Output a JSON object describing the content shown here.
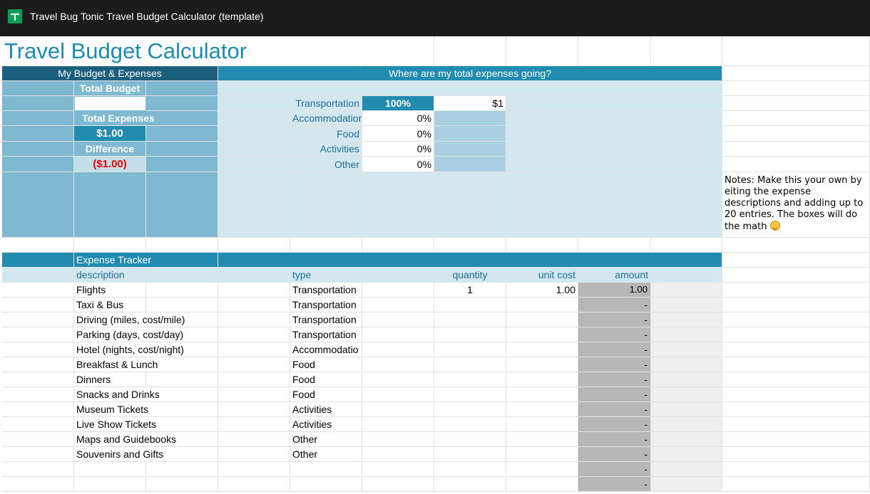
{
  "window": {
    "title": "Travel Bug Tonic Travel Budget Calculator (template)"
  },
  "sheet_title": "Travel Budget Calculator",
  "budget": {
    "header": "My Budget & Expenses",
    "total_budget_label": "Total Budget",
    "total_budget_value": "",
    "total_expenses_label": "Total Expenses",
    "total_expenses_value": "$1.00",
    "difference_label": "Difference",
    "difference_value": "($1.00)"
  },
  "breakdown": {
    "header": "Where are my total expenses going?",
    "rows": [
      {
        "category": "Transportation",
        "percent": "100%",
        "amount": "$1"
      },
      {
        "category": "Accommodation",
        "percent": "0%"
      },
      {
        "category": "Food",
        "percent": "0%"
      },
      {
        "category": "Activities",
        "percent": "0%"
      },
      {
        "category": "Other",
        "percent": "0%"
      }
    ]
  },
  "notes": {
    "text": "Notes: Make this your own by eiting the expense descriptions and adding up to 20 entries. The boxes will do the math"
  },
  "tracker": {
    "header": "Expense Tracker",
    "columns": {
      "description": "description",
      "type": "type",
      "quantity": "quantity",
      "unit_cost": "unit cost",
      "amount": "amount"
    },
    "rows": [
      {
        "description": "Flights",
        "type": "Transportation",
        "quantity": "1",
        "unit_cost": "1.00",
        "amount": "1.00"
      },
      {
        "description": "Taxi & Bus",
        "type": "Transportation",
        "quantity": "",
        "unit_cost": "",
        "amount": "-"
      },
      {
        "description": "Driving (miles, cost/mile)",
        "type": "Transportation",
        "quantity": "",
        "unit_cost": "",
        "amount": "-"
      },
      {
        "description": "Parking (days, cost/day)",
        "type": "Transportation",
        "quantity": "",
        "unit_cost": "",
        "amount": "-"
      },
      {
        "description": "Hotel (nights, cost/night)",
        "type": "Accommodatio",
        "quantity": "",
        "unit_cost": "",
        "amount": "-"
      },
      {
        "description": "Breakfast & Lunch",
        "type": "Food",
        "quantity": "",
        "unit_cost": "",
        "amount": "-"
      },
      {
        "description": "Dinners",
        "type": "Food",
        "quantity": "",
        "unit_cost": "",
        "amount": "-"
      },
      {
        "description": "Snacks and Drinks",
        "type": "Food",
        "quantity": "",
        "unit_cost": "",
        "amount": "-"
      },
      {
        "description": "Museum Tickets",
        "type": "Activities",
        "quantity": "",
        "unit_cost": "",
        "amount": "-"
      },
      {
        "description": "Live Show Tickets",
        "type": "Activities",
        "quantity": "",
        "unit_cost": "",
        "amount": "-"
      },
      {
        "description": "Maps and Guidebooks",
        "type": "Other",
        "quantity": "",
        "unit_cost": "",
        "amount": "-"
      },
      {
        "description": "Souvenirs and Gifts",
        "type": "Other",
        "quantity": "",
        "unit_cost": "",
        "amount": "-"
      },
      {
        "description": "",
        "type": "",
        "quantity": "",
        "unit_cost": "",
        "amount": "-"
      },
      {
        "description": "",
        "type": "",
        "quantity": "",
        "unit_cost": "",
        "amount": "-"
      }
    ]
  },
  "colors": {
    "accent": "#218bb0",
    "dark_header": "#1b5f7c",
    "negative": "#e60000"
  }
}
